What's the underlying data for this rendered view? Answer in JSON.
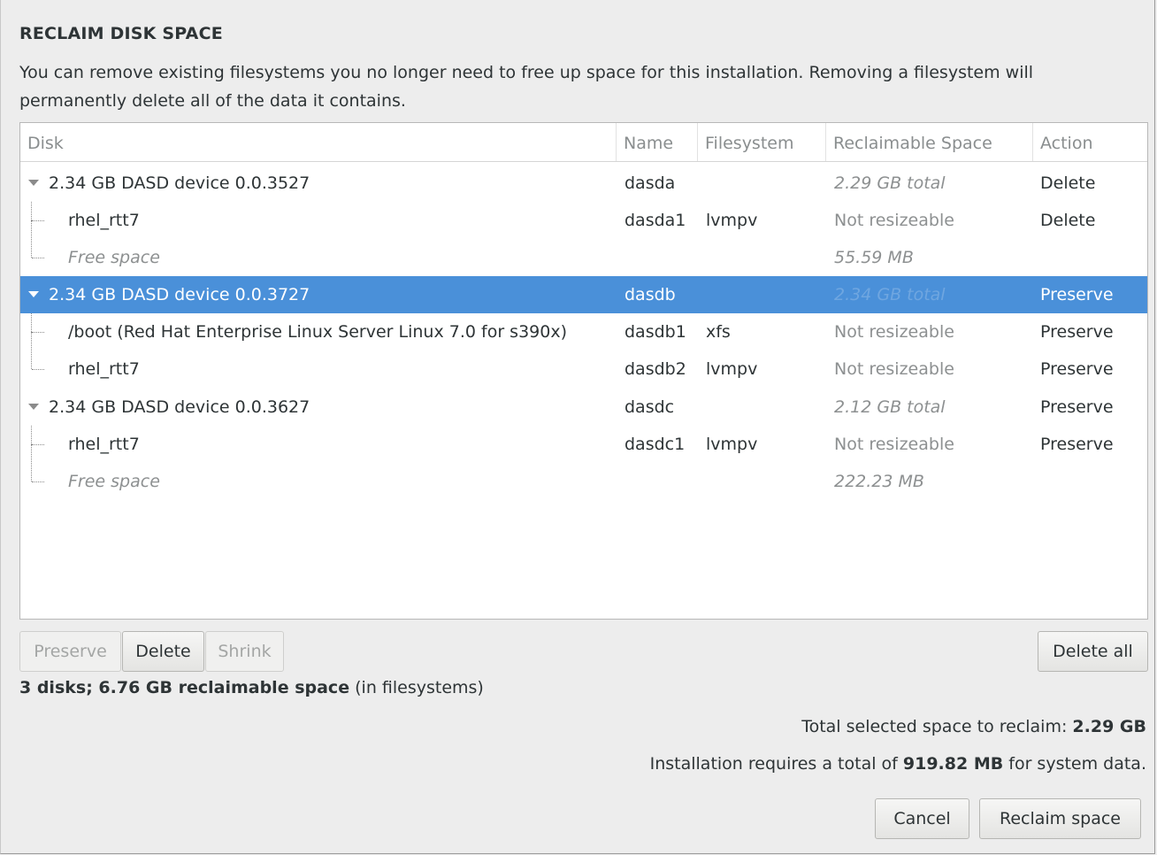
{
  "dialog": {
    "title": "RECLAIM DISK SPACE",
    "description": "You can remove existing filesystems you no longer need to free up space for this installation.  Removing a filesystem will permanently delete all of the data it contains."
  },
  "table": {
    "columns": [
      "Disk",
      "Name",
      "Filesystem",
      "Reclaimable Space",
      "Action"
    ],
    "rows": [
      {
        "disk": "2.34 GB DASD device 0.0.3527",
        "name": "dasda",
        "filesystem": "",
        "space": "2.29 GB total",
        "action": "Delete"
      },
      {
        "disk": "rhel_rtt7",
        "name": "dasda1",
        "filesystem": "lvmpv",
        "space": "Not resizeable",
        "action": "Delete"
      },
      {
        "disk": "Free space",
        "name": "",
        "filesystem": "",
        "space": "55.59 MB",
        "action": ""
      },
      {
        "disk": "2.34 GB DASD device 0.0.3727",
        "name": "dasdb",
        "filesystem": "",
        "space": "2.34 GB total",
        "action": "Preserve"
      },
      {
        "disk": "/boot (Red Hat Enterprise Linux Server Linux 7.0 for s390x)",
        "name": "dasdb1",
        "filesystem": "xfs",
        "space": "Not resizeable",
        "action": "Preserve"
      },
      {
        "disk": "rhel_rtt7",
        "name": "dasdb2",
        "filesystem": "lvmpv",
        "space": "Not resizeable",
        "action": "Preserve"
      },
      {
        "disk": "2.34 GB DASD device 0.0.3627",
        "name": "dasdc",
        "filesystem": "",
        "space": "2.12 GB total",
        "action": "Preserve"
      },
      {
        "disk": "rhel_rtt7",
        "name": "dasdc1",
        "filesystem": "lvmpv",
        "space": "Not resizeable",
        "action": "Preserve"
      },
      {
        "disk": "Free space",
        "name": "",
        "filesystem": "",
        "space": "222.23 MB",
        "action": ""
      }
    ],
    "selected_row": 3
  },
  "buttons": {
    "preserve": "Preserve",
    "delete": "Delete",
    "shrink": "Shrink",
    "delete_all": "Delete all",
    "cancel": "Cancel",
    "reclaim": "Reclaim space"
  },
  "summary": {
    "bold": "3 disks; 6.76 GB reclaimable space",
    "rest": " (in filesystems)"
  },
  "selected": {
    "label": "Total selected space to reclaim: ",
    "value": "2.29 GB"
  },
  "requirement": {
    "prefix": "Installation requires a total of ",
    "value": "919.82 MB",
    "suffix": " for system data."
  },
  "colors": {
    "selection": "#4a90d9",
    "background": "#ededed"
  }
}
